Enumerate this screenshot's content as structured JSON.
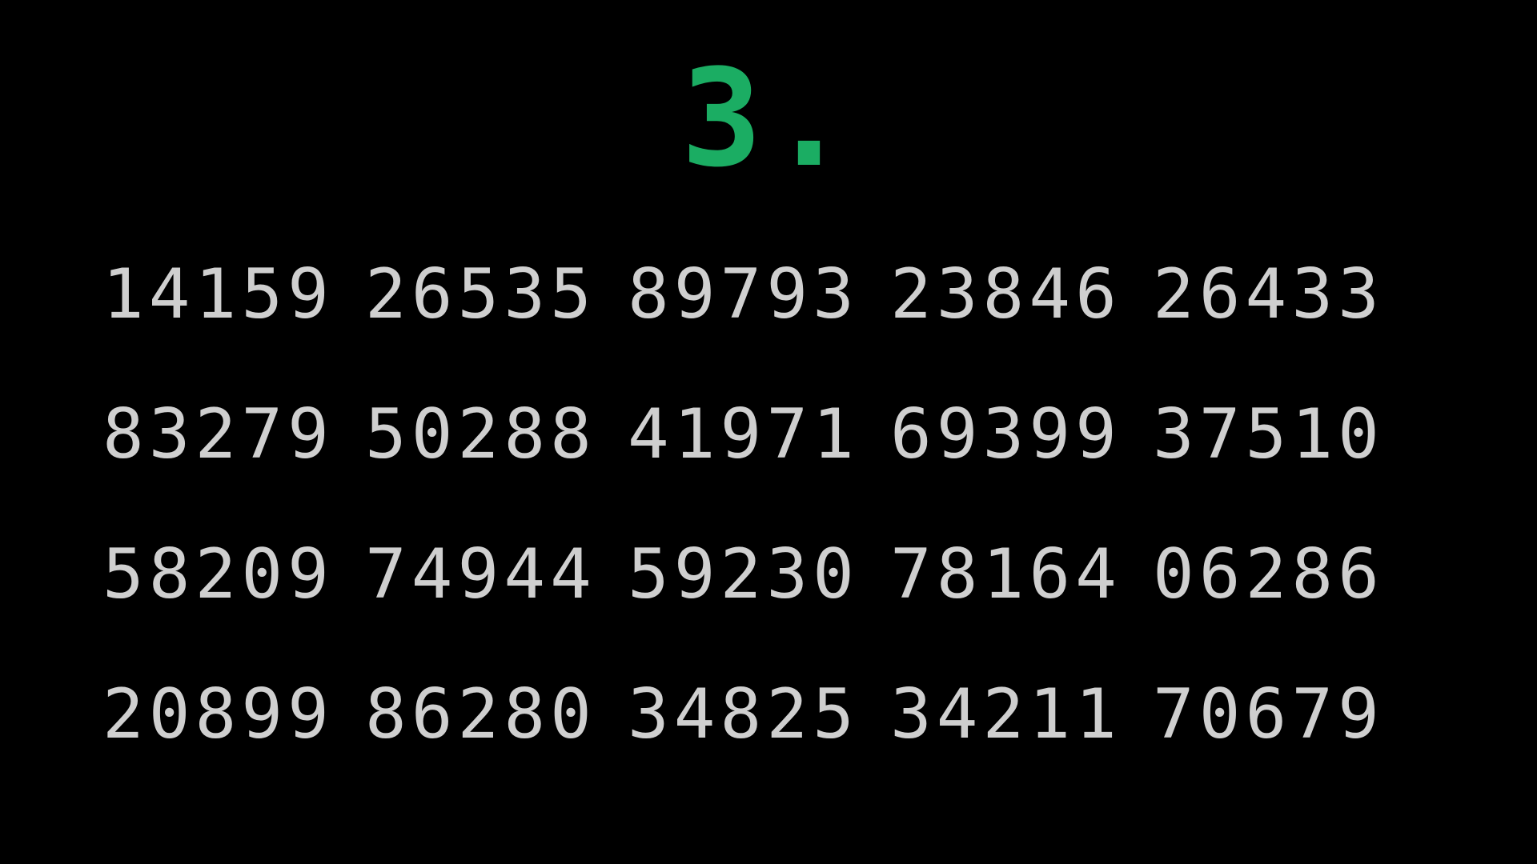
{
  "screen": {
    "header_text": "3.",
    "accent_color": "#1bad63",
    "digit_color": "#cfcfcf",
    "background_color": "#000000"
  },
  "rows": [
    [
      "14159",
      "26535",
      "89793",
      "23846",
      "26433"
    ],
    [
      "83279",
      "50288",
      "41971",
      "69399",
      "37510"
    ],
    [
      "58209",
      "74944",
      "59230",
      "78164",
      "06286"
    ],
    [
      "20899",
      "86280",
      "34825",
      "34211",
      "70679"
    ]
  ]
}
